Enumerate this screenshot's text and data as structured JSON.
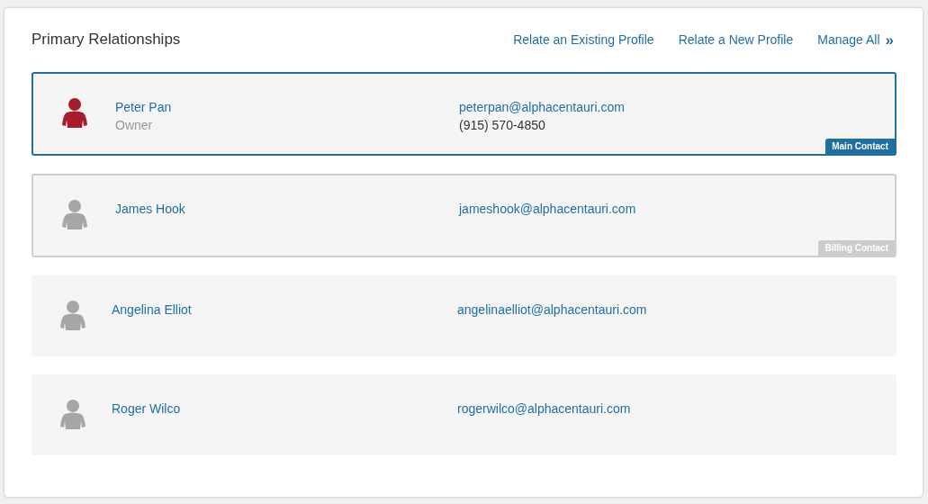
{
  "title": "Primary Relationships",
  "actions": [
    {
      "label": "Relate an Existing Profile"
    },
    {
      "label": "Relate a New Profile"
    },
    {
      "label": "Manage All",
      "icon": "»"
    }
  ],
  "contacts": [
    {
      "name": "Peter Pan",
      "role": "Owner",
      "email": "peterpan@alphacentauri.com",
      "phone": "(915) 570-4850",
      "color": "#a61c2a",
      "badge": {
        "kind": "main",
        "label": "Main Contact"
      }
    },
    {
      "name": "James Hook",
      "email": "jameshook@alphacentauri.com",
      "color": "#a6a6a6",
      "badge": {
        "kind": "billing",
        "label": "Billing Contact"
      }
    },
    {
      "name": "Angelina Elliot",
      "email": "angelinaelliot@alphacentauri.com",
      "color": "#a6a6a6"
    },
    {
      "name": "Roger Wilco",
      "email": "rogerwilco@alphacentauri.com",
      "color": "#a6a6a6"
    }
  ]
}
